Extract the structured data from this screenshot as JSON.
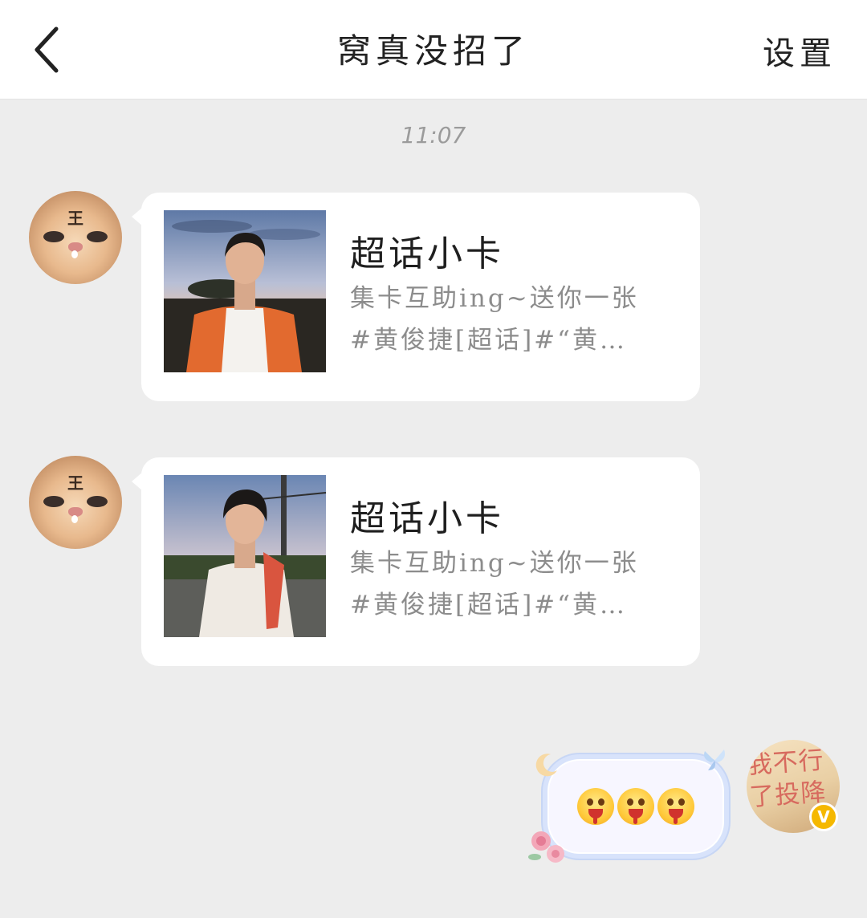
{
  "header": {
    "title": "窝真没招了",
    "settings_label": "设置"
  },
  "timestamp": "11:07",
  "messages": [
    {
      "sender": "other",
      "avatar_text": "王",
      "card": {
        "title": "超话小卡",
        "desc_line1": "集卡互助ing~送你一张",
        "desc_line2": "#黄俊捷[超话]#“黄…"
      }
    },
    {
      "sender": "other",
      "avatar_text": "王",
      "card": {
        "title": "超话小卡",
        "desc_line1": "集卡互助ing~送你一张",
        "desc_line2": "#黄俊捷[超话]#“黄…"
      }
    },
    {
      "sender": "me",
      "avatar_text": "我不行了投降",
      "badge": "V",
      "emoji_count": 3
    }
  ],
  "colors": {
    "background": "#ededed",
    "bubble": "#ffffff",
    "vip_badge": "#f5b800"
  }
}
